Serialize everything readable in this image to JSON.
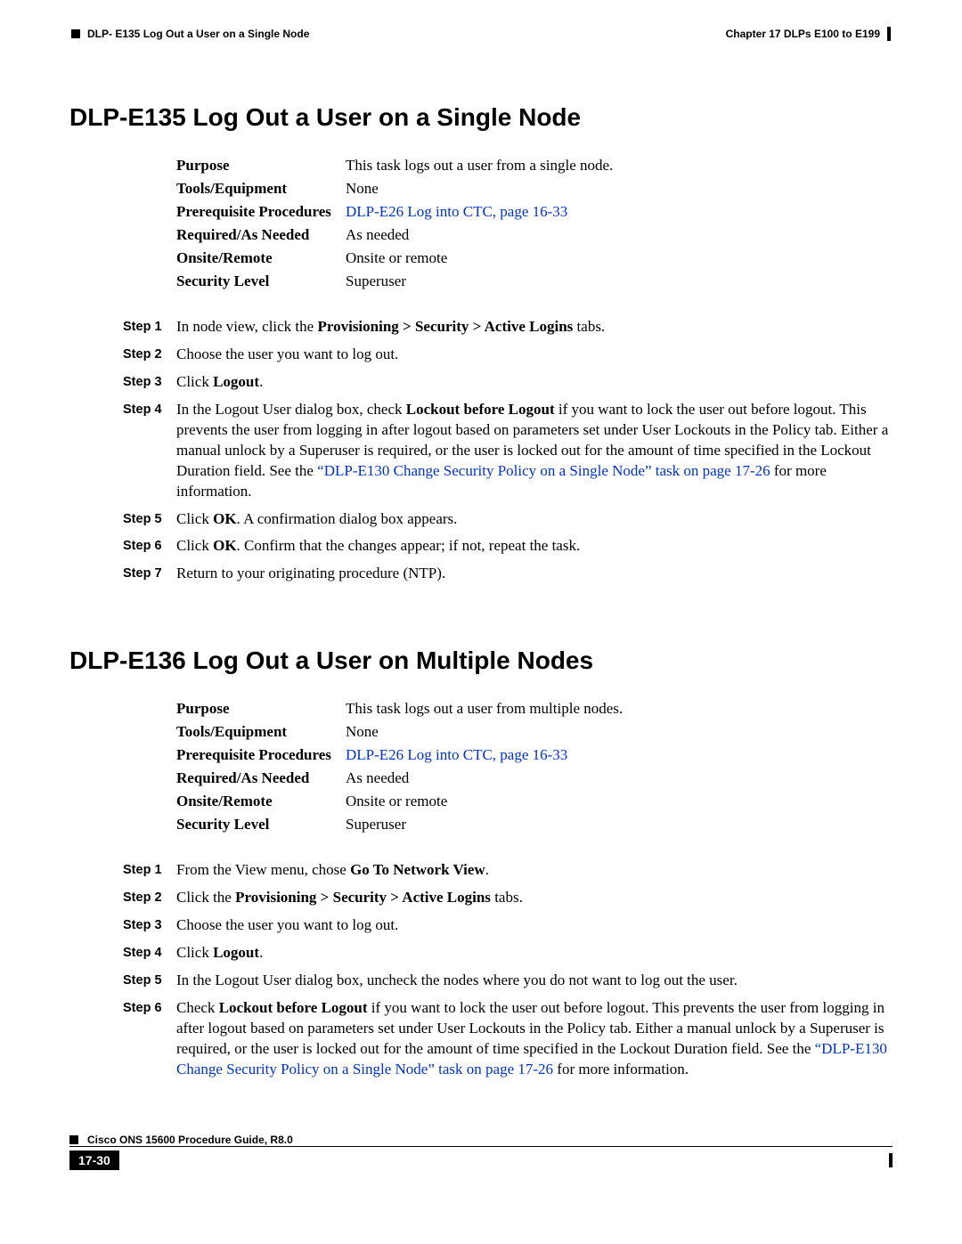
{
  "header": {
    "chapter": "Chapter 17  DLPs E100 to E199",
    "section": "DLP- E135 Log Out a User on a Single Node"
  },
  "s1": {
    "title": "DLP-E135 Log Out a User on a Single Node",
    "spec": {
      "purpose_l": "Purpose",
      "purpose_v": "This task logs out a user from a single node.",
      "tools_l": "Tools/Equipment",
      "tools_v": "None",
      "prereq_l": "Prerequisite Procedures",
      "prereq_link": "DLP-E26 Log into CTC, page 16-33",
      "required_l": "Required/As Needed",
      "required_v": "As needed",
      "onsite_l": "Onsite/Remote",
      "onsite_v": "Onsite or remote",
      "security_l": "Security Level",
      "security_v": "Superuser"
    },
    "steps": {
      "s1l": "Step 1",
      "s1a": "In node view, click the ",
      "s1b": "Provisioning > Security > Active Logins",
      "s1c": " tabs.",
      "s2l": "Step 2",
      "s2": "Choose the user you want to log out.",
      "s3l": "Step 3",
      "s3a": "Click ",
      "s3b": "Logout",
      "s3c": ".",
      "s4l": "Step 4",
      "s4a": "In the Logout User dialog box, check ",
      "s4b": "Lockout before Logout",
      "s4c": " if you want to lock the user out before logout. This prevents the user from logging in after logout based on parameters set under User Lockouts in the Policy tab. Either a manual unlock by a Superuser is required, or the user is locked out for the amount of time specified in the Lockout Duration field. See the ",
      "s4link": "“DLP-E130 Change Security Policy on a Single Node” task on page 17-26",
      "s4d": " for more information.",
      "s5l": "Step 5",
      "s5a": "Click ",
      "s5b": "OK",
      "s5c": ". A confirmation dialog box appears.",
      "s6l": "Step 6",
      "s6a": "Click ",
      "s6b": "OK",
      "s6c": ". Confirm that the changes appear; if not, repeat the task.",
      "s7l": "Step 7",
      "s7": "Return to your originating procedure (NTP)."
    }
  },
  "s2": {
    "title": "DLP-E136 Log Out a User on Multiple Nodes",
    "spec": {
      "purpose_l": "Purpose",
      "purpose_v": "This task logs out a user from multiple nodes.",
      "tools_l": "Tools/Equipment",
      "tools_v": "None",
      "prereq_l": "Prerequisite Procedures",
      "prereq_link": "DLP-E26 Log into CTC, page 16-33",
      "required_l": "Required/As Needed",
      "required_v": "As needed",
      "onsite_l": "Onsite/Remote",
      "onsite_v": "Onsite or remote",
      "security_l": "Security Level",
      "security_v": "Superuser"
    },
    "steps": {
      "s1l": "Step 1",
      "s1a": "From the View menu, chose ",
      "s1b": "Go To Network View",
      "s1c": ".",
      "s2l": "Step 2",
      "s2a": "Click the ",
      "s2b": "Provisioning > Security > Active Logins",
      "s2c": " tabs.",
      "s3l": "Step 3",
      "s3": "Choose the user you want to log out.",
      "s4l": "Step 4",
      "s4a": "Click ",
      "s4b": "Logout",
      "s4c": ".",
      "s5l": "Step 5",
      "s5": "In the Logout User dialog box, uncheck the nodes where you do not want to log out the user.",
      "s6l": "Step 6",
      "s6a": "Check ",
      "s6b": "Lockout before Logout",
      "s6c": " if you want to lock the user out before logout. This prevents the user from logging in after logout based on parameters set under User Lockouts in the Policy tab. Either a manual unlock by a Superuser is required, or the user is locked out for the amount of time specified in the Lockout Duration field. See the ",
      "s6link": "“DLP-E130 Change Security Policy on a Single Node” task on page 17-26",
      "s6d": " for more information."
    }
  },
  "footer": {
    "guide": "Cisco ONS 15600 Procedure Guide, R8.0",
    "page": "17-30"
  }
}
